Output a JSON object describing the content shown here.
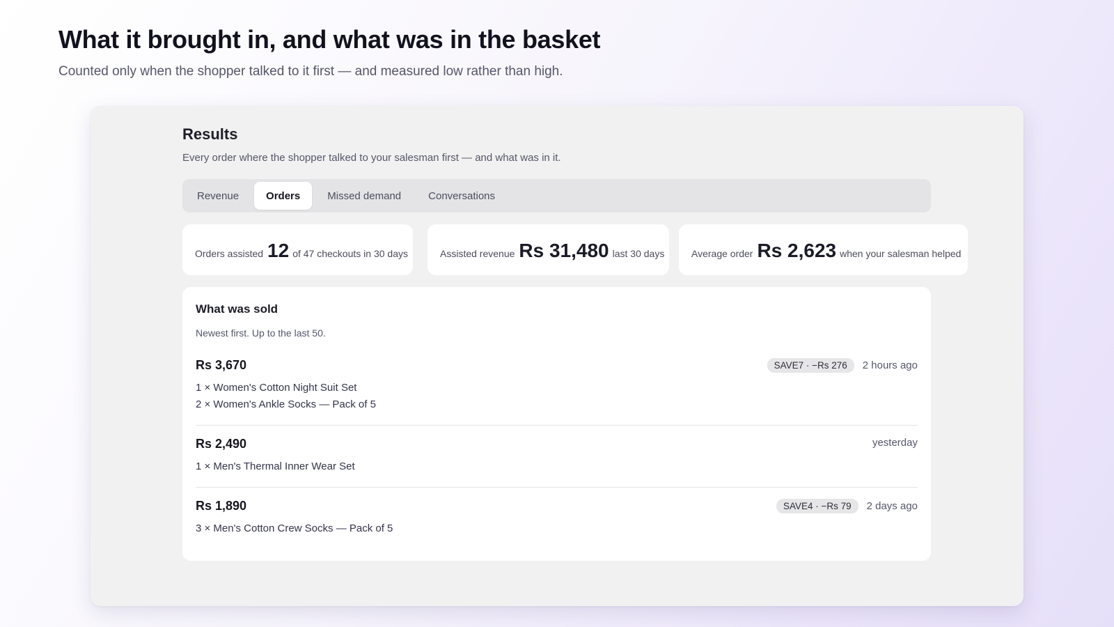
{
  "hero": {
    "title": "What it brought in, and what was in the basket",
    "subtitle": "Counted only when the shopper talked to it first — and measured low rather than high."
  },
  "results": {
    "title": "Results",
    "description": "Every order where the shopper talked to your salesman first — and what was in it.",
    "tabs": [
      {
        "label": "Revenue",
        "active": false
      },
      {
        "label": "Orders",
        "active": true
      },
      {
        "label": "Missed demand",
        "active": false
      },
      {
        "label": "Conversations",
        "active": false
      }
    ]
  },
  "stats": [
    {
      "label": "Orders assisted",
      "value": "12",
      "suffix": "of 47 checkouts in 30 days"
    },
    {
      "label": "Assisted revenue",
      "value": "Rs 31,480",
      "suffix": "last 30 days"
    },
    {
      "label": "Average order",
      "value": "Rs 2,623",
      "suffix": "when your salesman helped"
    }
  ],
  "orders": {
    "heading": "What was sold",
    "note": "Newest first. Up to the last 50.",
    "list": [
      {
        "amount": "Rs 3,670",
        "discount": "SAVE7 · −Rs 276",
        "when": "2 hours ago",
        "items": [
          "1 × Women's Cotton Night Suit Set",
          "2 × Women's Ankle Socks — Pack of 5"
        ]
      },
      {
        "amount": "Rs 2,490",
        "discount": "",
        "when": "yesterday",
        "items": [
          "1 × Men's Thermal Inner Wear Set"
        ]
      },
      {
        "amount": "Rs 1,890",
        "discount": "SAVE4 · −Rs 79",
        "when": "2 days ago",
        "items": [
          "3 × Men's Cotton Crew Socks — Pack of 5"
        ]
      }
    ]
  }
}
